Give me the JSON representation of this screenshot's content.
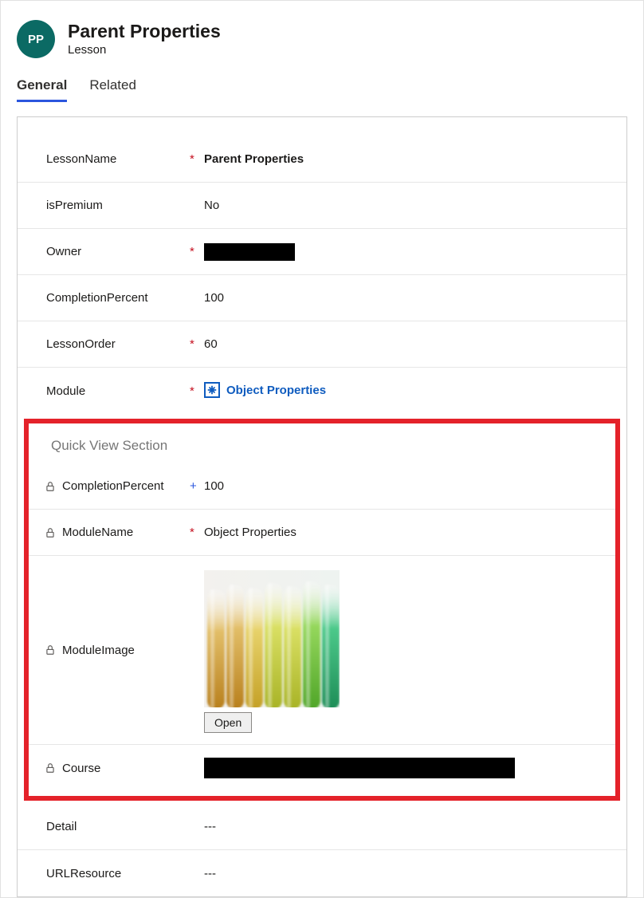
{
  "header": {
    "avatar_initials": "PP",
    "title": "Parent Properties",
    "subtitle": "Lesson"
  },
  "tabs": {
    "general": "General",
    "related": "Related"
  },
  "fields": {
    "lessonName": {
      "label": "LessonName",
      "value": "Parent Properties"
    },
    "isPremium": {
      "label": "isPremium",
      "value": "No"
    },
    "owner": {
      "label": "Owner"
    },
    "completionPercent": {
      "label": "CompletionPercent",
      "value": "100"
    },
    "lessonOrder": {
      "label": "LessonOrder",
      "value": "60"
    },
    "module": {
      "label": "Module",
      "value": "Object Properties"
    },
    "detail": {
      "label": "Detail",
      "value": "---"
    },
    "urlResource": {
      "label": "URLResource",
      "value": "---"
    }
  },
  "quickView": {
    "title": "Quick View Section",
    "completionPercent": {
      "label": "CompletionPercent",
      "value": "100"
    },
    "moduleName": {
      "label": "ModuleName",
      "value": "Object Properties"
    },
    "moduleImage": {
      "label": "ModuleImage",
      "open_label": "Open"
    },
    "course": {
      "label": "Course"
    }
  }
}
